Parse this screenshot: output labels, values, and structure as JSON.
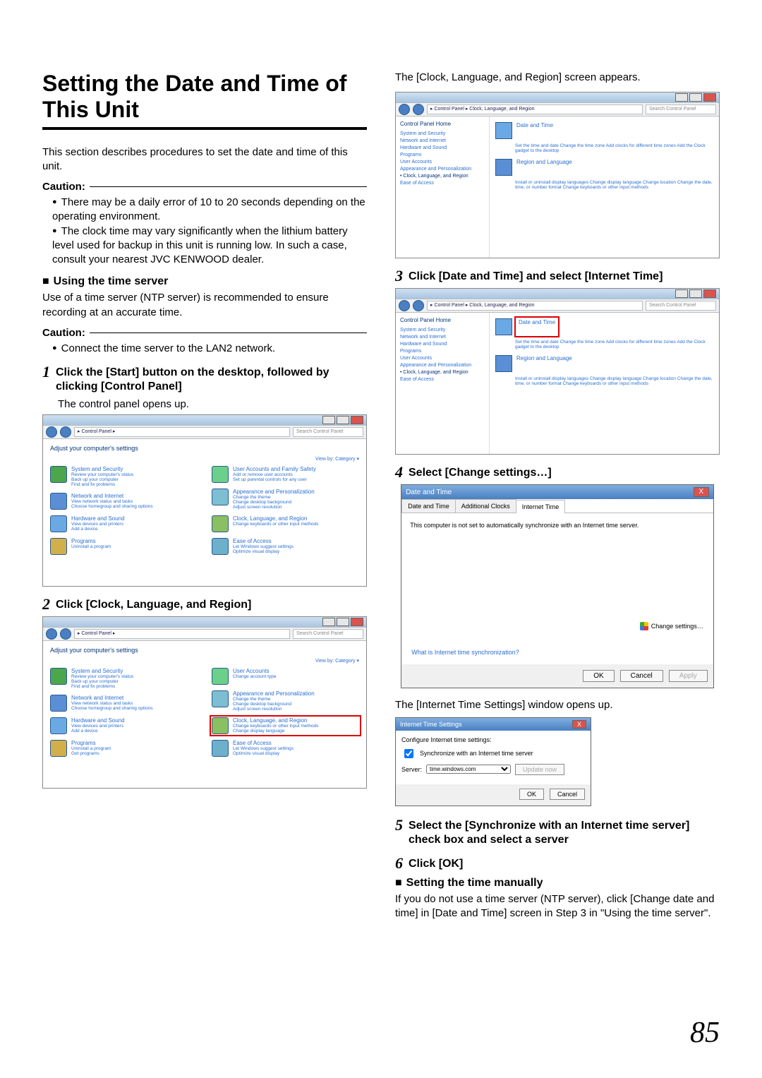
{
  "title": "Setting the Date and Time of This Unit",
  "intro": "This section describes procedures to set the date and time of this unit.",
  "caution_label": "Caution:",
  "caution_items_1": [
    "There may be a daily error of 10 to 20 seconds depending on the operating environment.",
    "The clock time may vary significantly when the lithium battery level used for backup in this unit is running low. In such a case, consult your nearest JVC KENWOOD dealer."
  ],
  "time_server_heading": "Using the time server",
  "time_server_body": "Use of a time server (NTP server) is recommended to ensure recording at an accurate time.",
  "caution_items_2": [
    "Connect the time server to the LAN2 network."
  ],
  "steps": {
    "s1": "Click the [Start] button on the desktop, followed by clicking [Control Panel]",
    "s1_result": "The control panel opens up.",
    "s2": "Click [Clock, Language, and Region]",
    "col2_top": "The [Clock, Language, and Region] screen appears.",
    "s3": "Click [Date and Time] and select [Internet Time]",
    "s4": "Select [Change settings…]",
    "s4_result": "The [Internet Time Settings] window opens up.",
    "s5": "Select the [Synchronize with an Internet time server] check box and select a server",
    "s6": "Click [OK]"
  },
  "manual_heading": "Setting the time manually",
  "manual_body": "If you do not use a time server (NTP server), click [Change date and time] in [Date and Time] screen in Step 3 in \"Using the time server\".",
  "page_number": "85",
  "cp": {
    "path": "▸ Control Panel ▸",
    "search_placeholder": "Search Control Panel",
    "adjust": "Adjust your computer's settings",
    "viewby": "View by:   Category ▾",
    "items": {
      "sys": "System and Security",
      "sys_l1": "Review your computer's status",
      "sys_l2": "Back up your computer",
      "sys_l3": "Find and fix problems",
      "net": "Network and Internet",
      "net_l1": "View network status and tasks",
      "net_l2": "Choose homegroup and sharing options",
      "hw": "Hardware and Sound",
      "hw_l1": "View devices and printers",
      "hw_l2": "Add a device",
      "prog": "Programs",
      "prog_l1": "Uninstall a program",
      "prog_l2": "Get programs",
      "user": "User Accounts and Family Safety",
      "user_l1": "Add or remove user accounts",
      "user_l2": "Set up parental controls for any user",
      "user_s": "User Accounts",
      "user_s_l1": "Change account type",
      "appear": "Appearance and Personalization",
      "appear_l1": "Change the theme",
      "appear_l2": "Change desktop background",
      "appear_l3": "Adjust screen resolution",
      "clock": "Clock, Language, and Region",
      "clock_l1": "Change keyboards or other input methods",
      "clock_l2": "Change display language",
      "ease": "Ease of Access",
      "ease_l1": "Let Windows suggest settings",
      "ease_l2": "Optimize visual display"
    }
  },
  "clr": {
    "path": "▸ Control Panel ▸ Clock, Language, and Region",
    "side_home": "Control Panel Home",
    "side_links": [
      "System and Security",
      "Network and Internet",
      "Hardware and Sound",
      "Programs",
      "User Accounts",
      "Appearance and Personalization"
    ],
    "side_current": "Clock, Language, and Region",
    "side_last": "Ease of Access",
    "date_h": "Date and Time",
    "date_links": "Set the time and date    Change the time zone    Add clocks for different time zones    Add the Clock gadget to the desktop",
    "region_h": "Region and Language",
    "region_links": "Install or uninstall display languages    Change display language    Change location    Change the date, time, or number format    Change keyboards or other input methods"
  },
  "dlg": {
    "title": "Date and Time",
    "tab1": "Date and Time",
    "tab2": "Additional Clocks",
    "tab3": "Internet Time",
    "notset": "This computer is not set to automatically synchronize with an Internet time server.",
    "change": "Change settings…",
    "whatis": "What is Internet time synchronization?",
    "ok": "OK",
    "cancel": "Cancel",
    "apply": "Apply",
    "close": "X"
  },
  "dlg2": {
    "title": "Internet Time Settings",
    "configure": "Configure Internet time settings:",
    "sync": "Synchronize with an Internet time server",
    "server_label": "Server:",
    "server_value": "time.windows.com",
    "update": "Update now",
    "ok": "OK",
    "cancel": "Cancel",
    "close": "X"
  }
}
